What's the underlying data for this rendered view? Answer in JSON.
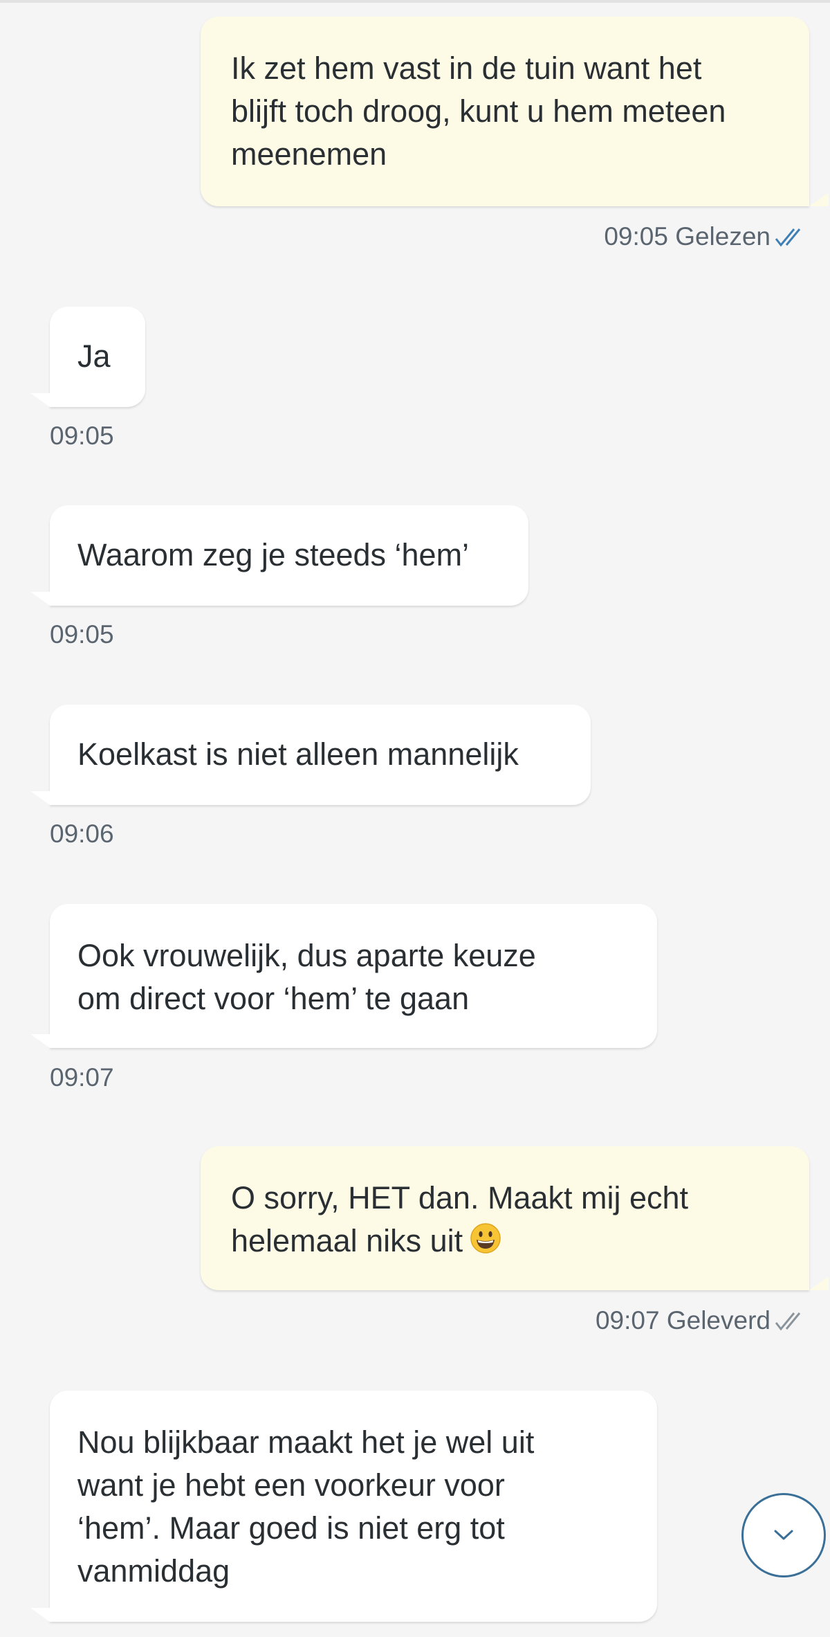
{
  "messages": [
    {
      "direction": "out",
      "lines": [
        "Ik zet hem vast in de tuin want het",
        "blijft toch droog, kunt u hem meteen",
        "meenemen"
      ],
      "time": "09:05",
      "status": "Gelezen",
      "status_icon": "double-check-icon"
    },
    {
      "direction": "in",
      "lines": [
        "Ja"
      ],
      "time": "09:05"
    },
    {
      "direction": "in",
      "lines": [
        "Waarom zeg je steeds ‘hem’"
      ],
      "time": "09:05"
    },
    {
      "direction": "in",
      "lines": [
        "Koelkast is niet alleen mannelijk"
      ],
      "time": "09:06"
    },
    {
      "direction": "in",
      "lines": [
        "Ook vrouwelijk, dus aparte keuze",
        "om direct voor ‘hem’ te gaan"
      ],
      "time": "09:07"
    },
    {
      "direction": "out",
      "lines": [
        "O sorry, HET dan. Maakt mij echt",
        "helemaal niks uit"
      ],
      "emoji": "grinning-face-emoji",
      "time": "09:07",
      "status": "Geleverd",
      "status_icon": "double-check-icon"
    },
    {
      "direction": "in",
      "lines": [
        "Nou blijkbaar maakt het je wel uit",
        "want je hebt een voorkeur voor",
        "‘hem’. Maar goed is niet erg tot",
        "vanmiddag"
      ]
    }
  ],
  "scroll_button_icon": "chevron-down-icon",
  "colors": {
    "background": "#f5f5f5",
    "outgoing_bubble": "#fdfbe6",
    "incoming_bubble": "#ffffff",
    "text": "#2a2f33",
    "meta_text": "#5b6570",
    "read_check": "#3f7fb5",
    "delivered_check": "#8a949c",
    "scroll_button_border": "#3a6f98"
  }
}
